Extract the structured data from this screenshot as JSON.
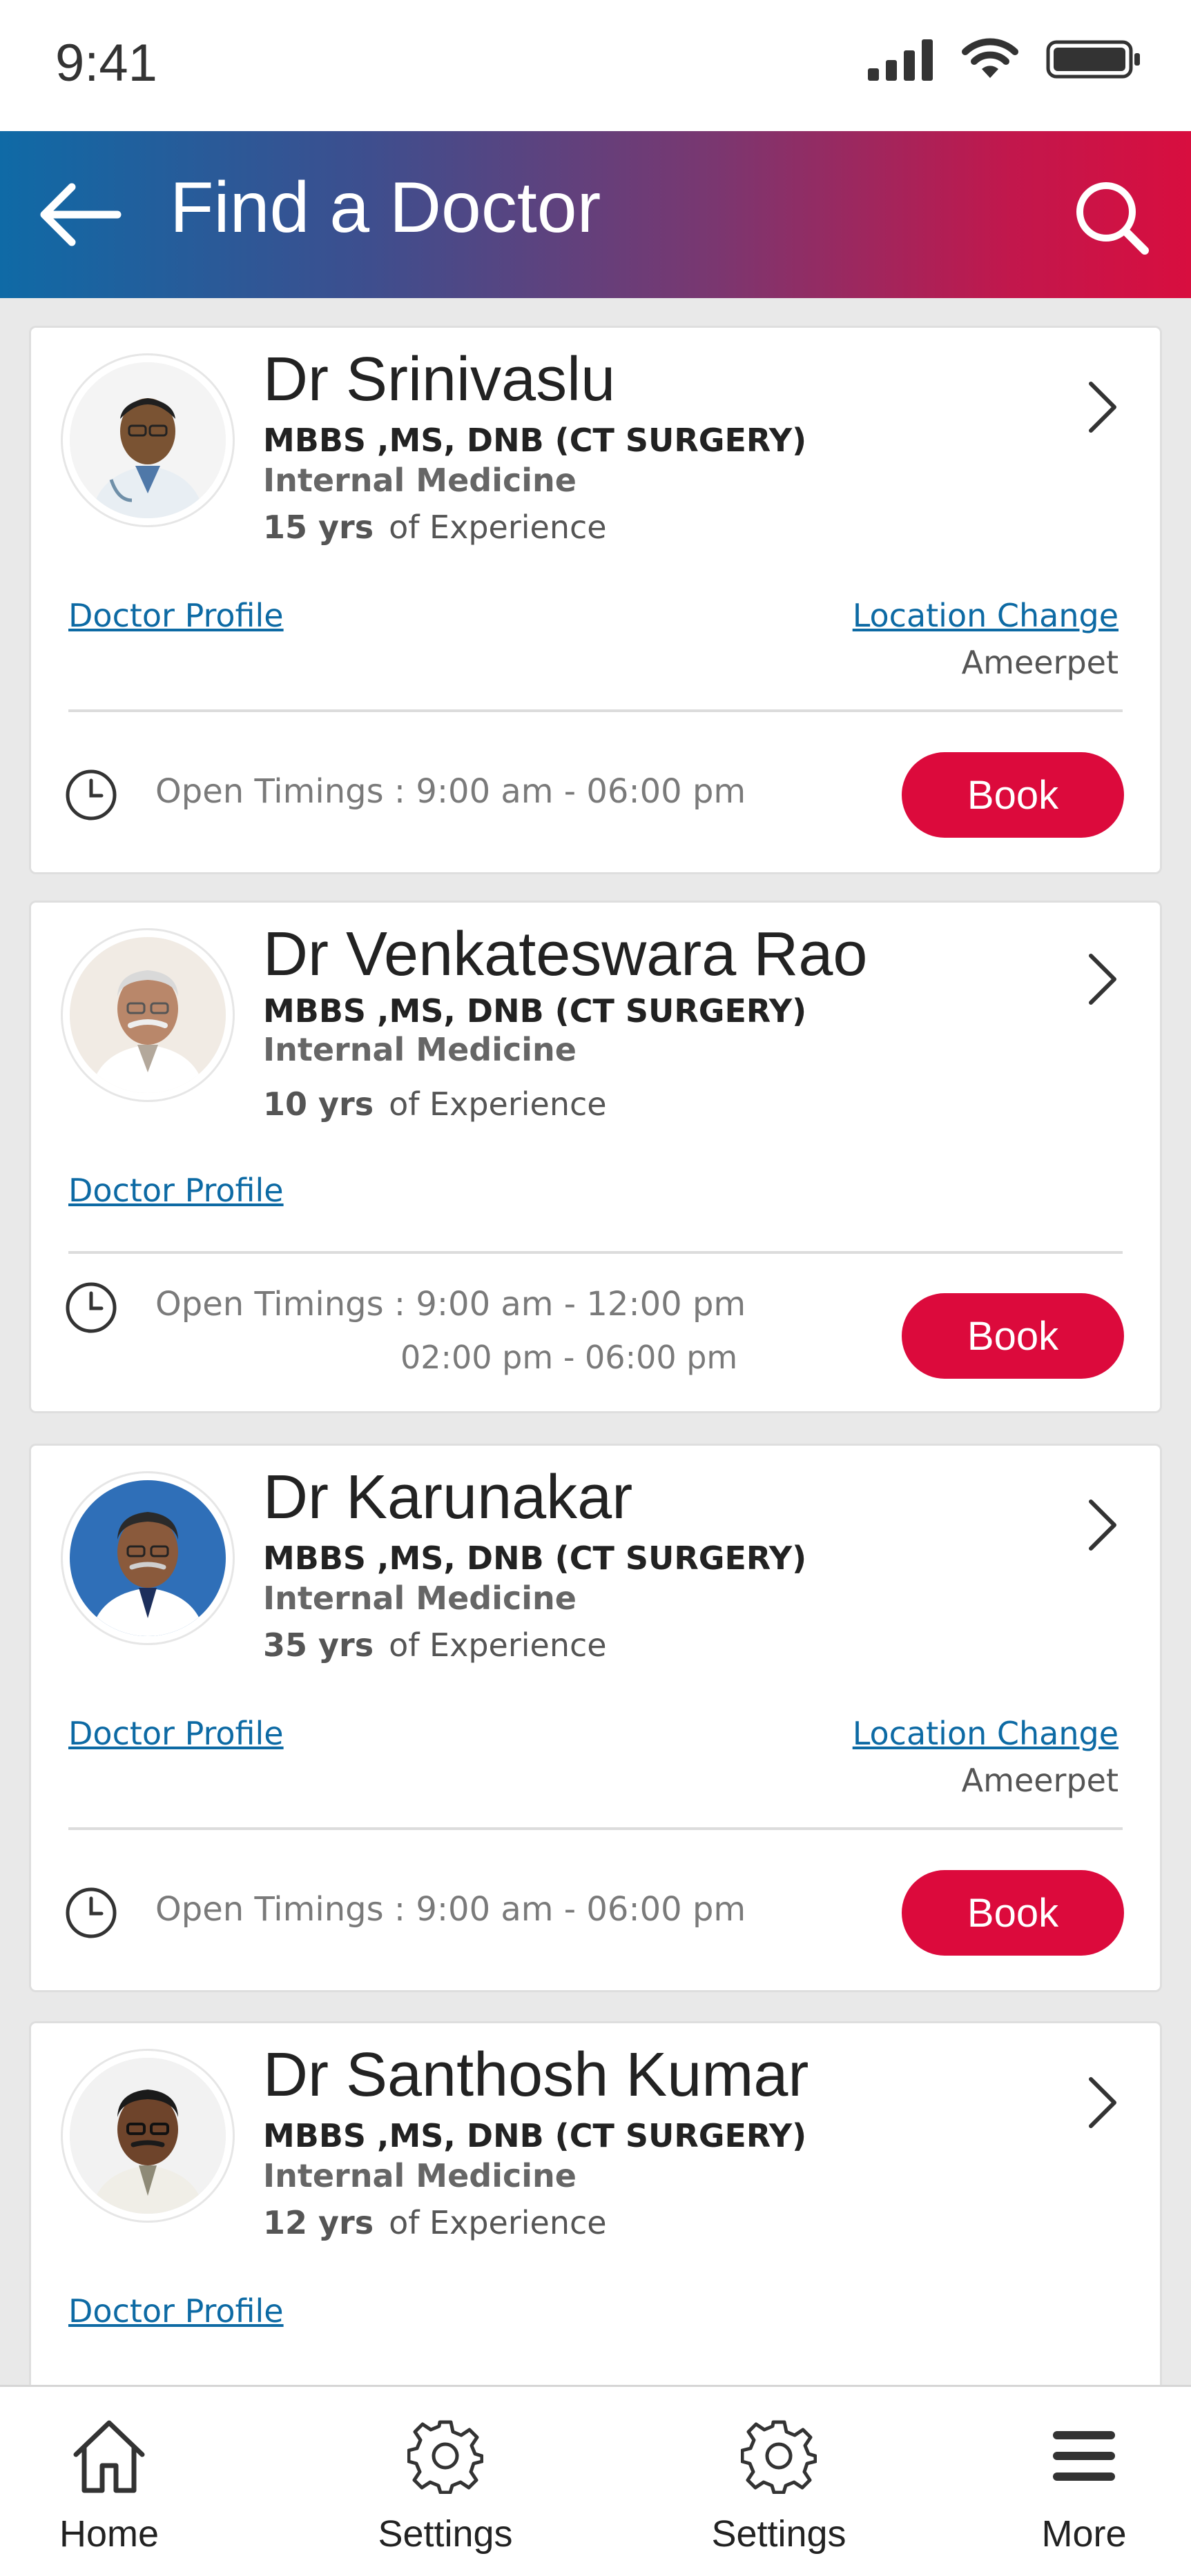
{
  "status_bar": {
    "time": "9:41"
  },
  "header": {
    "title": "Find a Doctor"
  },
  "doctors": [
    {
      "name": "Dr Srinivaslu",
      "qualification": "MBBS ,MS, DNB (CT SURGERY)",
      "specialty": "Internal Medicine",
      "experience_years": "15 yrs",
      "experience_suffix": "of Experience",
      "profile_link": "Doctor Profile",
      "location_change": "Location Change",
      "location": "Ameerpet",
      "timings_label": "Open Timings : 9:00 am - 06:00 pm",
      "book_label": "Book"
    },
    {
      "name": "Dr Venkateswara Rao",
      "qualification": "MBBS ,MS, DNB (CT SURGERY)",
      "specialty": "Internal Medicine",
      "experience_years": "10 yrs",
      "experience_suffix": "of Experience",
      "profile_link": "Doctor Profile",
      "timings_label": "Open Timings : 9:00 am - 12:00 pm",
      "timings_label_2": "02:00 pm - 06:00 pm",
      "book_label": "Book"
    },
    {
      "name": "Dr Karunakar",
      "qualification": "MBBS ,MS, DNB (CT SURGERY)",
      "specialty": "Internal Medicine",
      "experience_years": "35 yrs",
      "experience_suffix": "of Experience",
      "profile_link": "Doctor Profile",
      "location_change": "Location Change",
      "location": "Ameerpet",
      "timings_label": "Open Timings : 9:00 am - 06:00 pm",
      "book_label": "Book"
    },
    {
      "name": "Dr Santhosh Kumar",
      "qualification": "MBBS ,MS, DNB (CT SURGERY)",
      "specialty": "Internal Medicine",
      "experience_years": "12 yrs",
      "experience_suffix": "of Experience",
      "profile_link": "Doctor Profile"
    }
  ],
  "bottom_nav": [
    {
      "label": "Home",
      "icon": "home-icon"
    },
    {
      "label": "Settings",
      "icon": "gear-icon"
    },
    {
      "label": "Settings",
      "icon": "gear-icon"
    },
    {
      "label": "More",
      "icon": "menu-icon"
    }
  ],
  "colors": {
    "header_gradient_start": "#0f6aa6",
    "header_gradient_end": "#d80e3f",
    "book_button": "#dc0a3c",
    "link": "#0d6aa4"
  }
}
